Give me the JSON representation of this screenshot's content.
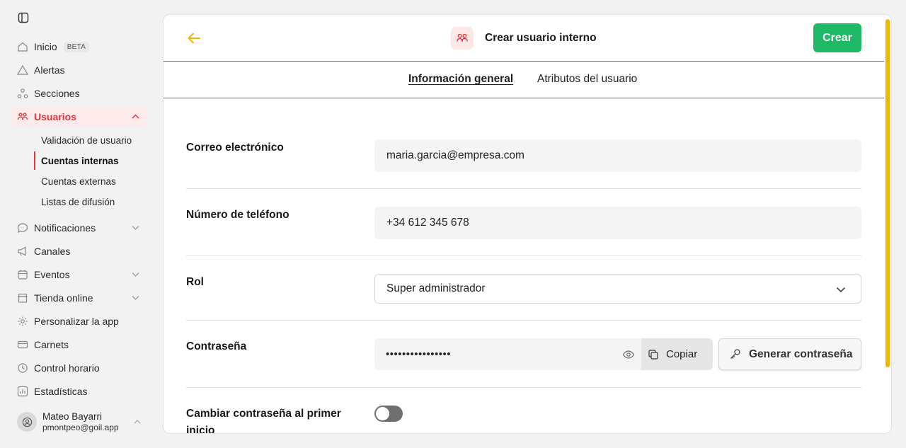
{
  "sidebar": {
    "items": [
      {
        "label": "Inicio",
        "badge": "BETA",
        "icon": "home-icon"
      },
      {
        "label": "Alertas",
        "icon": "alert-icon"
      },
      {
        "label": "Secciones",
        "icon": "sections-icon"
      },
      {
        "label": "Usuarios",
        "icon": "users-icon",
        "active": true,
        "expanded": true
      },
      {
        "label": "Notificaciones",
        "icon": "chat-icon",
        "has_children": true
      },
      {
        "label": "Canales",
        "icon": "megaphone-icon"
      },
      {
        "label": "Eventos",
        "icon": "calendar-icon",
        "has_children": true
      },
      {
        "label": "Tienda online",
        "icon": "store-icon",
        "has_children": true
      },
      {
        "label": "Personalizar la app",
        "icon": "gear-icon"
      },
      {
        "label": "Carnets",
        "icon": "card-icon"
      },
      {
        "label": "Control horario",
        "icon": "clock-icon"
      },
      {
        "label": "Estadísticas",
        "icon": "chart-icon"
      }
    ],
    "subitems": [
      {
        "label": "Validación de usuario"
      },
      {
        "label": "Cuentas internas",
        "active": true
      },
      {
        "label": "Cuentas externas"
      },
      {
        "label": "Listas de difusión"
      }
    ],
    "user": {
      "name": "Mateo Bayarri",
      "email": "pmontpeo@goil.app"
    }
  },
  "header": {
    "title": "Crear usuario interno",
    "create_label": "Crear"
  },
  "tabs": [
    {
      "label": "Información general",
      "active": true
    },
    {
      "label": "Atributos del usuario"
    }
  ],
  "form": {
    "email": {
      "label": "Correo electrónico",
      "value": "maria.garcia@empresa.com"
    },
    "phone": {
      "label": "Número de teléfono",
      "value": "+34 612 345 678"
    },
    "role": {
      "label": "Rol",
      "value": "Super administrador"
    },
    "password": {
      "label": "Contraseña",
      "value": "••••••••••••••••",
      "copy_label": "Copiar",
      "generate_label": "Generar contraseña"
    },
    "change_password": {
      "label": "Cambiar contraseña al primer inicio",
      "enabled": false
    }
  },
  "colors": {
    "accent": "#e0383e",
    "primary": "#1fb866",
    "back_arrow": "#f2b705",
    "scrollbar": "#f2b705"
  }
}
